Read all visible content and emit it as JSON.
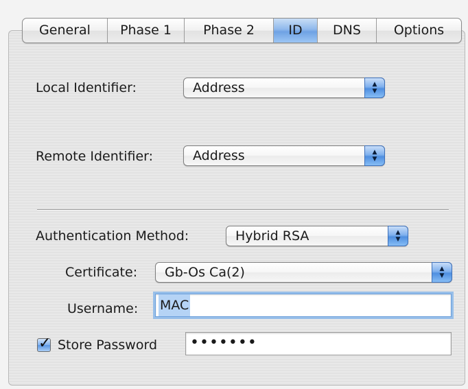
{
  "tabs": [
    {
      "label": "General"
    },
    {
      "label": "Phase 1"
    },
    {
      "label": "Phase 2"
    },
    {
      "label": "ID"
    },
    {
      "label": "DNS"
    },
    {
      "label": "Options"
    }
  ],
  "active_tab": "ID",
  "local_identifier": {
    "label": "Local Identifier:",
    "value": "Address"
  },
  "remote_identifier": {
    "label": "Remote Identifier:",
    "value": "Address"
  },
  "auth_method": {
    "label": "Authentication Method:",
    "value": "Hybrid RSA"
  },
  "certificate": {
    "label": "Certificate:",
    "value": "Gb-Os Ca(2)"
  },
  "username": {
    "label": "Username:",
    "value": "MAC"
  },
  "store_password": {
    "label": "Store Password",
    "checked": true,
    "value": "•••••••"
  },
  "colors": {
    "accent": "#6fa2e4",
    "focus_ring": "#98bfe9",
    "selection": "#b5d3f5"
  }
}
